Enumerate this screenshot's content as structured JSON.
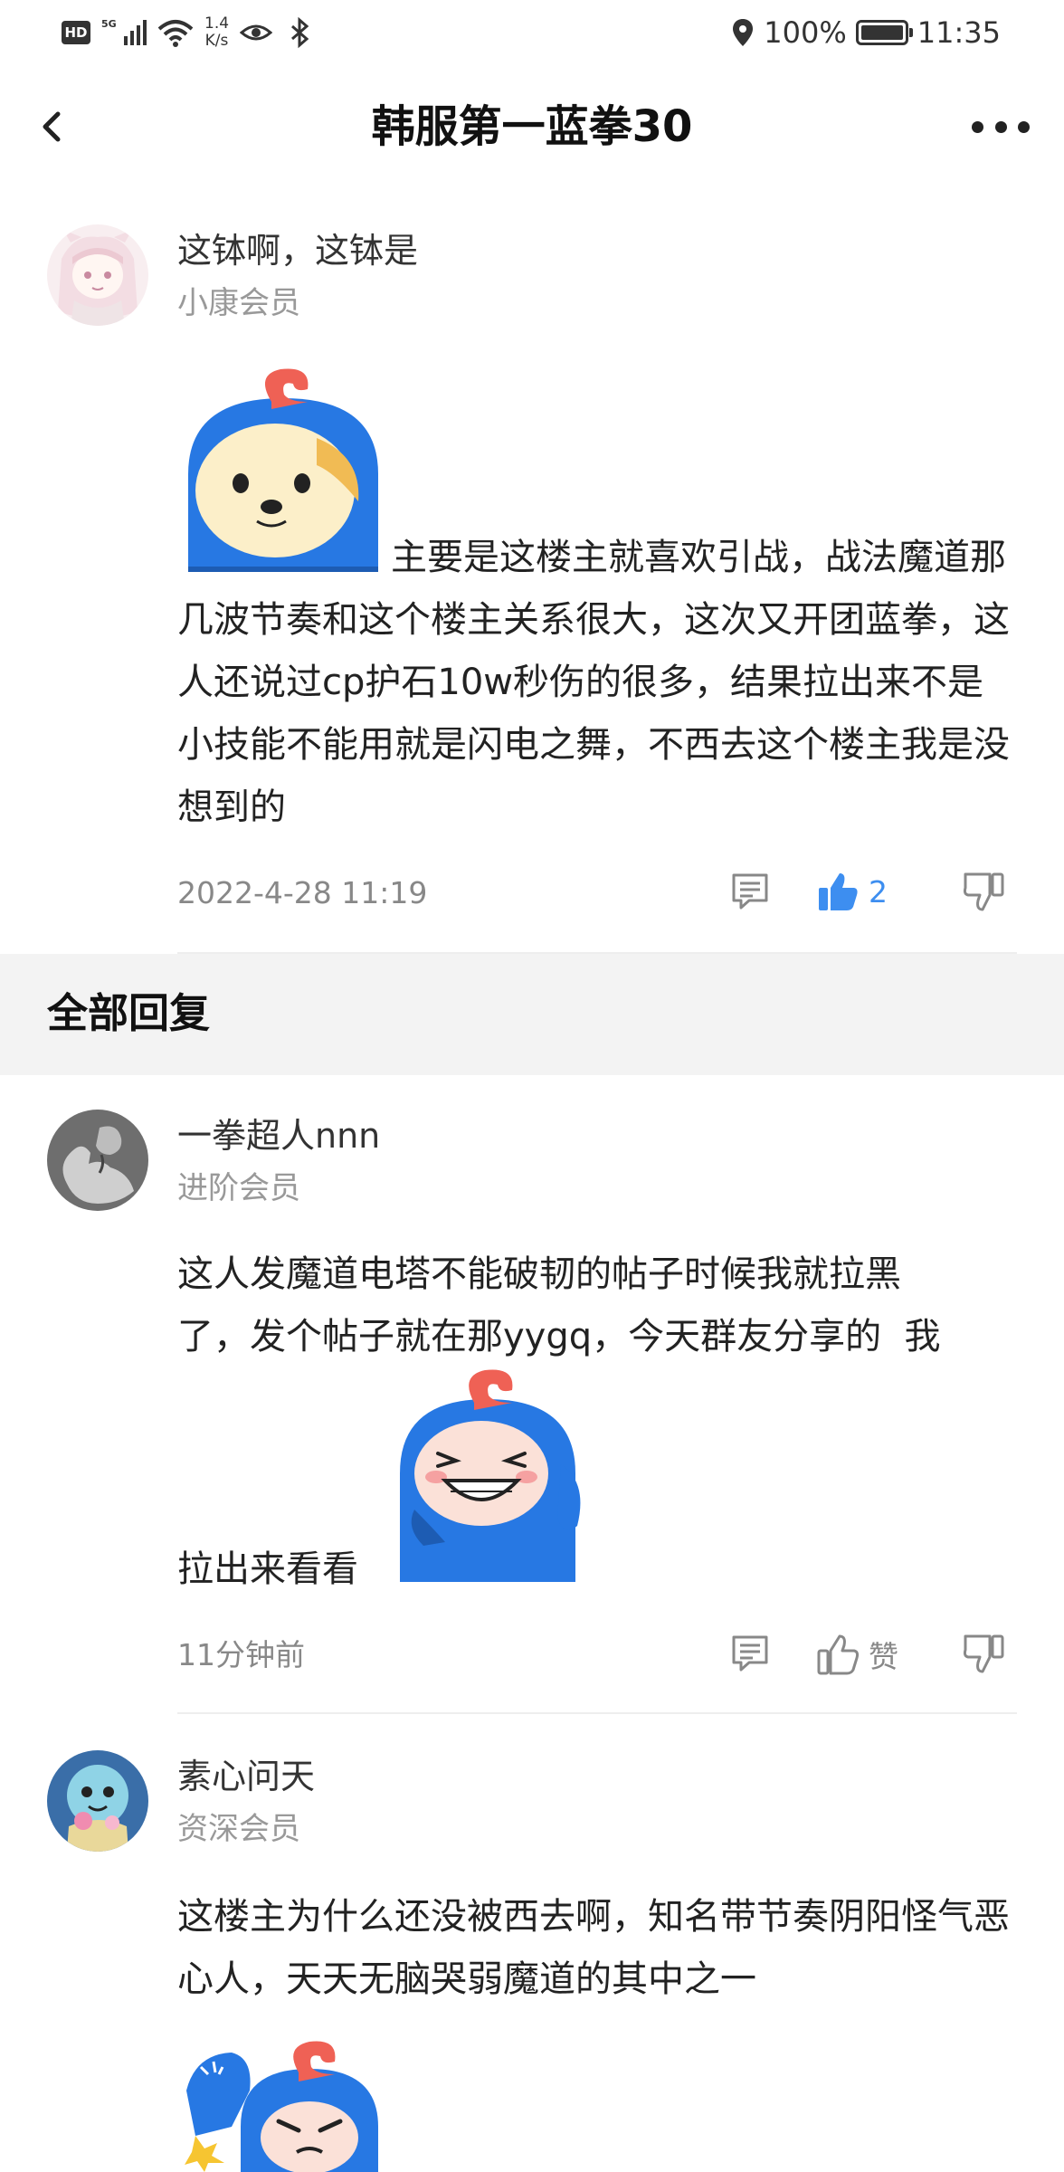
{
  "status_bar": {
    "hd": "HD",
    "network": "5G",
    "speed_top": "1.4",
    "speed_bottom": "K/s",
    "battery": "100%",
    "time": "11:35",
    "battery_level": 1.0
  },
  "nav": {
    "title": "韩服第一蓝拳30",
    "back_icon": "back-chevron-icon",
    "more_icon": "more-dots-icon"
  },
  "main_comment": {
    "username": "这钵啊，这钵是",
    "level": "小康会员",
    "text": "主要是这楼主就喜欢引战，战法魔道那几波节奏和这个楼主关系很大，这次又开团蓝拳，这人还说过cp护石10w秒伤的很多，结果拉出来不是小技能不能用就是闪电之舞，不西去这个楼主我是没想到的",
    "timestamp": "2022-4-28 11:19",
    "like_count": "2",
    "sticker_icon": "blue-mascot-dog-sticker",
    "colors": {
      "like_active": "#3d8ef0"
    }
  },
  "section": {
    "title": "全部回复"
  },
  "replies": [
    {
      "username": "一拳超人nnn",
      "level": "进阶会员",
      "text_line1": "这人发魔道电塔不能破韧的帖子时候我就拉黑",
      "text_line2": "了，发个帖子就在那yygq，今天群友分享的  我",
      "text_line3": "拉出来看看",
      "time": "11分钟前",
      "like_label": "赞",
      "sticker_icon": "blue-mascot-grin-sticker"
    },
    {
      "username": "素心问天",
      "level": "资深会员",
      "text": "这楼主为什么还没被西去啊，知名带节奏阴阳怪气恶心人，天天无脑哭弱魔道的其中之一",
      "sticker_icon": "blue-mascot-angry-sticker"
    }
  ]
}
